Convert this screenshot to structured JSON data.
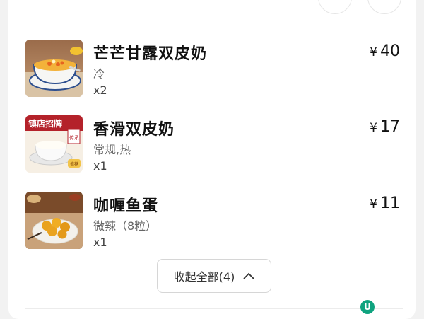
{
  "order": {
    "items": [
      {
        "name": "芒芒甘露双皮奶",
        "spec": "冷",
        "qty": "x2",
        "currency": "¥",
        "price": "40",
        "image": "mango-pomelo-milk-pudding"
      },
      {
        "name": "香滑双皮奶",
        "spec": "常规,热",
        "qty": "x1",
        "currency": "¥",
        "price": "17",
        "image": "double-skin-milk-pudding",
        "badge_text": "镇店招牌",
        "tag_text": "传承",
        "label_text": "推荐"
      },
      {
        "name": "咖喱鱼蛋",
        "spec": "微辣（8粒）",
        "qty": "x1",
        "currency": "¥",
        "price": "11",
        "image": "curry-fish-balls"
      }
    ],
    "collapse_label": "收起全部(4)"
  },
  "colors": {
    "accent": "#0fa37f",
    "badge_red": "#b4222a"
  },
  "brand_mark": "U"
}
